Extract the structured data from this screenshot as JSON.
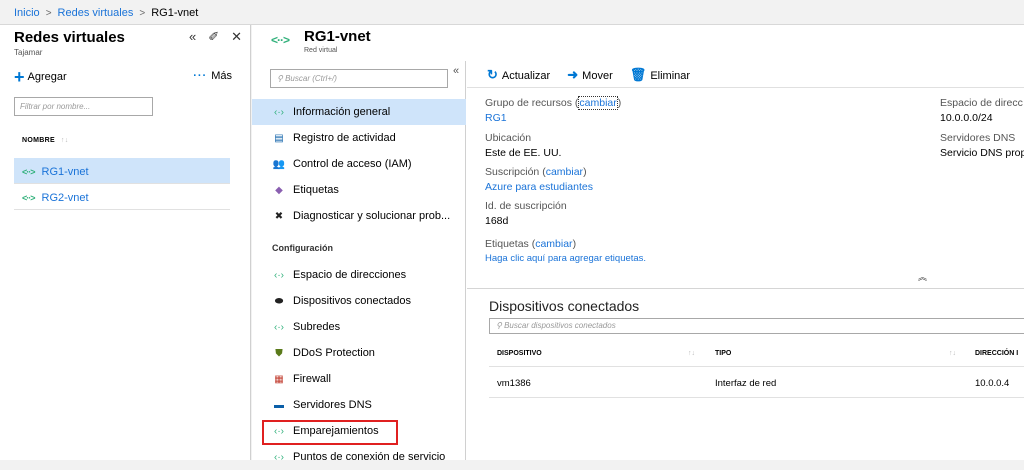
{
  "breadcrumb": {
    "home": "Inicio",
    "parent": "Redes virtuales",
    "current": "RG1-vnet",
    "separator": ">"
  },
  "list_blade": {
    "title": "Redes virtuales",
    "subtitle": "Tajamar",
    "add_label": "Agregar",
    "more_label": "Más",
    "filter_placeholder": "Filtrar por nombre...",
    "column_header": "NOMBRE",
    "items": [
      {
        "name": "RG1-vnet",
        "selected": true
      },
      {
        "name": "RG2-vnet",
        "selected": false
      }
    ]
  },
  "resource": {
    "name": "RG1-vnet",
    "type": "Red virtual",
    "menu_search_placeholder": "Buscar (Ctrl+/)",
    "menu": [
      {
        "label": "Información general",
        "icon": "network-icon",
        "selected": true
      },
      {
        "label": "Registro de actividad",
        "icon": "log-icon"
      },
      {
        "label": "Control de acceso (IAM)",
        "icon": "people-icon"
      },
      {
        "label": "Etiquetas",
        "icon": "tag-icon"
      },
      {
        "label": "Diagnosticar y solucionar prob...",
        "icon": "wrench-icon"
      }
    ],
    "settings_section": "Configuración",
    "settings": [
      {
        "label": "Espacio de direcciones",
        "icon": "network-icon"
      },
      {
        "label": "Dispositivos conectados",
        "icon": "device-icon"
      },
      {
        "label": "Subredes",
        "icon": "network-icon"
      },
      {
        "label": "DDoS Protection",
        "icon": "shield-icon"
      },
      {
        "label": "Firewall",
        "icon": "firewall-icon"
      },
      {
        "label": "Servidores DNS",
        "icon": "dns-icon"
      },
      {
        "label": "Emparejamientos",
        "icon": "peering-icon",
        "highlighted": true
      },
      {
        "label": "Puntos de conexión de servicio",
        "icon": "endpoint-icon"
      }
    ]
  },
  "toolbar": {
    "refresh": "Actualizar",
    "move": "Mover",
    "delete": "Eliminar"
  },
  "essentials": {
    "resource_group_label": "Grupo de recursos",
    "change": "cambiar",
    "resource_group": "RG1",
    "location_label": "Ubicación",
    "location": "Este de EE. UU.",
    "subscription_label": "Suscripción",
    "subscription": "Azure para estudiantes",
    "subscription_id_label": "Id. de suscripción",
    "subscription_id": "168d",
    "tags_label": "Etiquetas",
    "tags_link": "Haga clic aquí para agregar etiquetas.",
    "address_space_label": "Espacio de direcc",
    "address_space": "10.0.0.0/24",
    "dns_label": "Servidores DNS",
    "dns": "Servicio DNS prop"
  },
  "devices": {
    "title": "Dispositivos conectados",
    "search_placeholder": "Buscar dispositivos conectados",
    "headers": {
      "device": "DISPOSITIVO",
      "type": "TIPO",
      "address": "DIRECCIÓN I"
    },
    "rows": [
      {
        "device": "vm1386",
        "type": "Interfaz de red",
        "address": "10.0.0.4"
      }
    ]
  },
  "colors": {
    "accent": "#0078d4",
    "link": "#1a73d8",
    "selected": "#cfe4fa",
    "highlight": "#e02020",
    "vnet": "#2fb07a"
  }
}
